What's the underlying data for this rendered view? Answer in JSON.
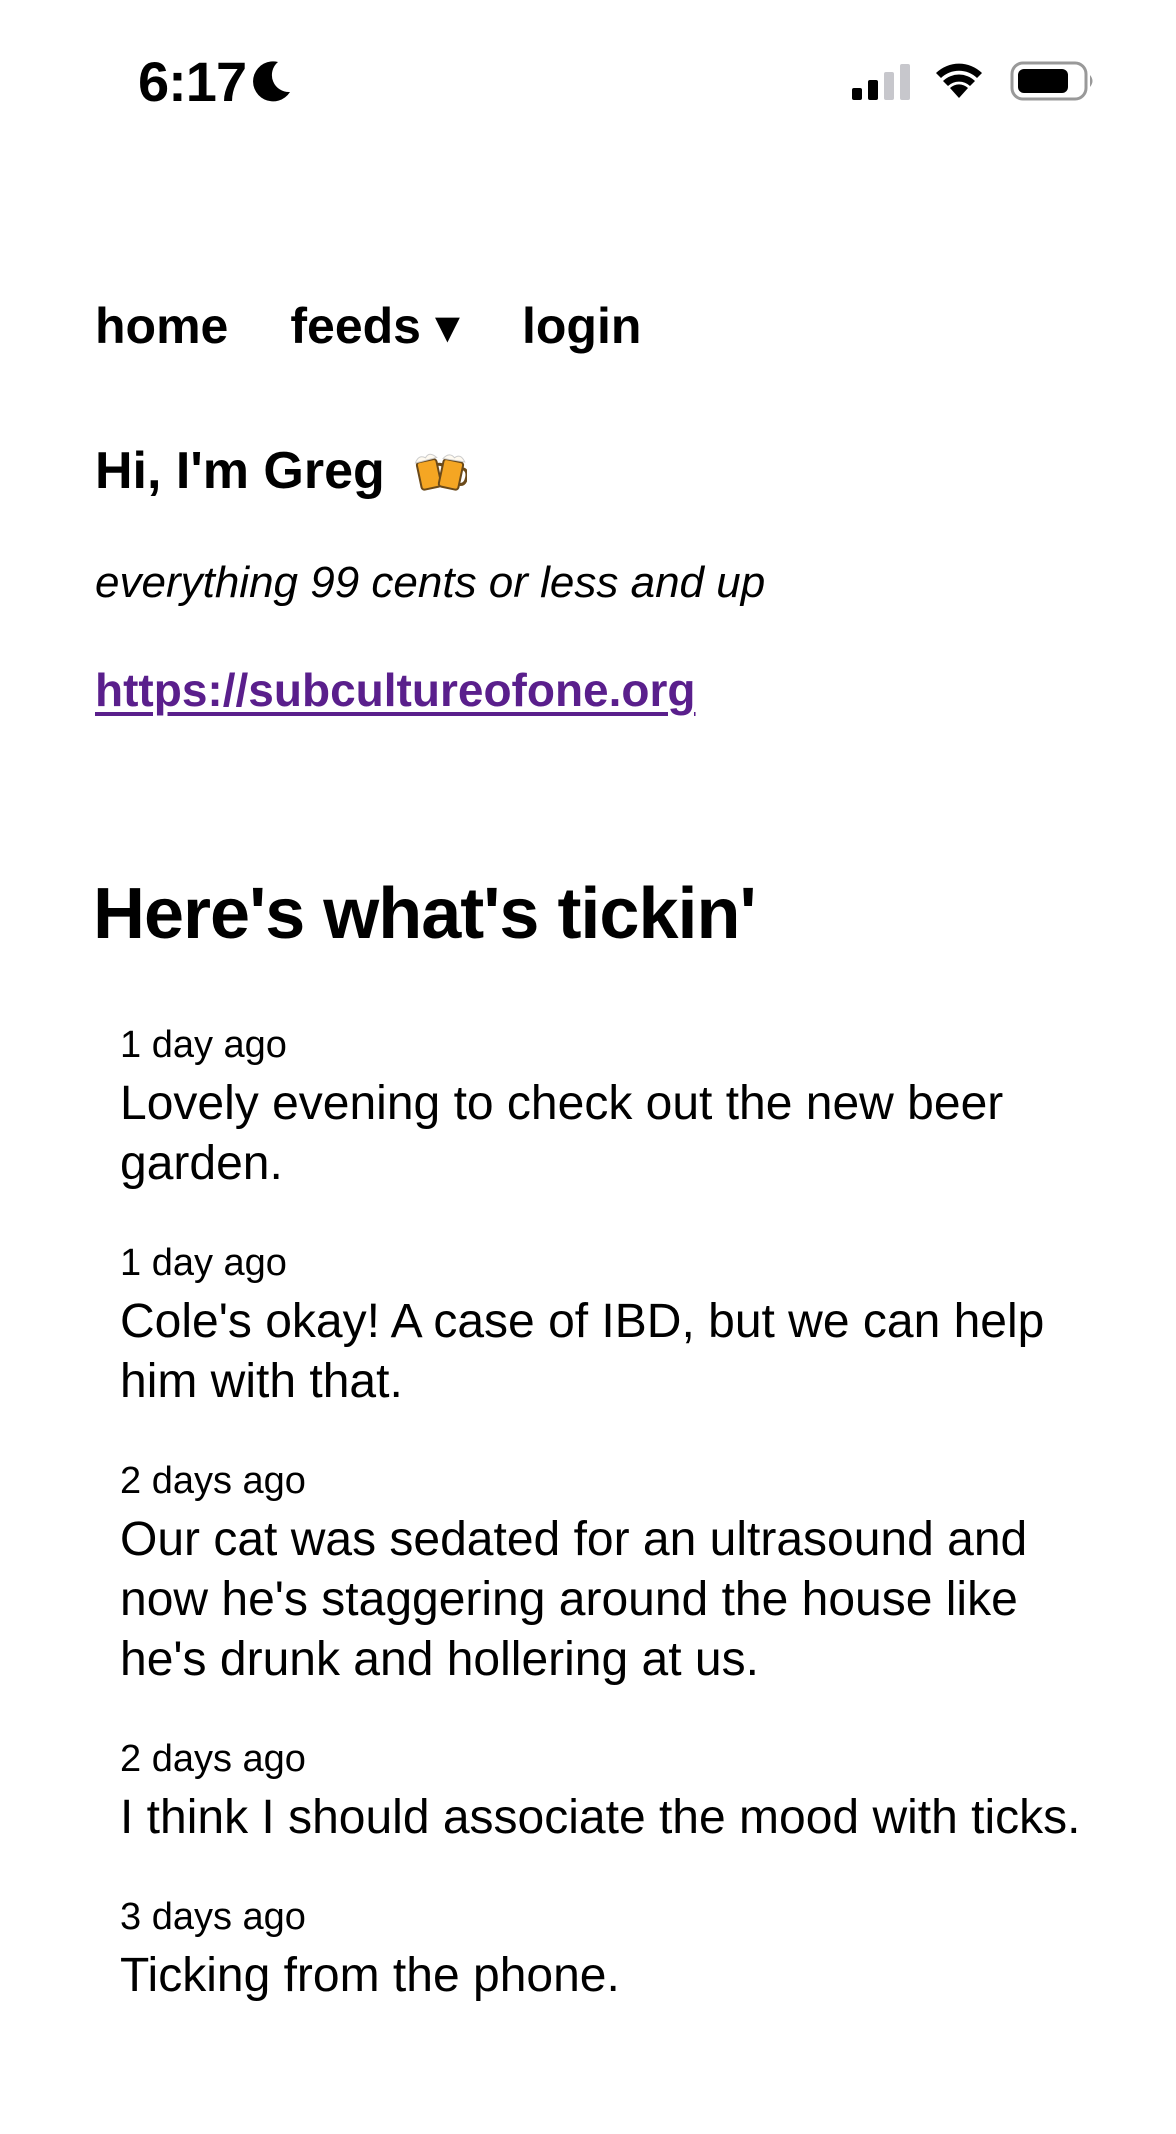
{
  "status_bar": {
    "time": "6:17"
  },
  "nav": {
    "home": "home",
    "feeds": "feeds ▾",
    "login": "login"
  },
  "profile": {
    "greeting": "Hi, I'm Greg",
    "tagline": "everything 99 cents or less and up",
    "link": "https://subcultureofone.org"
  },
  "section": {
    "heading": "Here's what's tickin'"
  },
  "feed": {
    "items": [
      {
        "time": "1 day ago",
        "text": "Lovely evening to check out the new beer garden."
      },
      {
        "time": "1 day ago",
        "text": "Cole's okay! A case of IBD, but we can help him with that."
      },
      {
        "time": "2 days ago",
        "text": "Our cat was sedated for an ultrasound and now he's staggering around the house like he's drunk and hollering at us."
      },
      {
        "time": "2 days ago",
        "text": "I think I should associate the mood with ticks."
      },
      {
        "time": "3 days ago",
        "text": "Ticking from the phone."
      }
    ]
  },
  "colors": {
    "link": "#5a1f8c",
    "text": "#000000",
    "background": "#ffffff"
  }
}
